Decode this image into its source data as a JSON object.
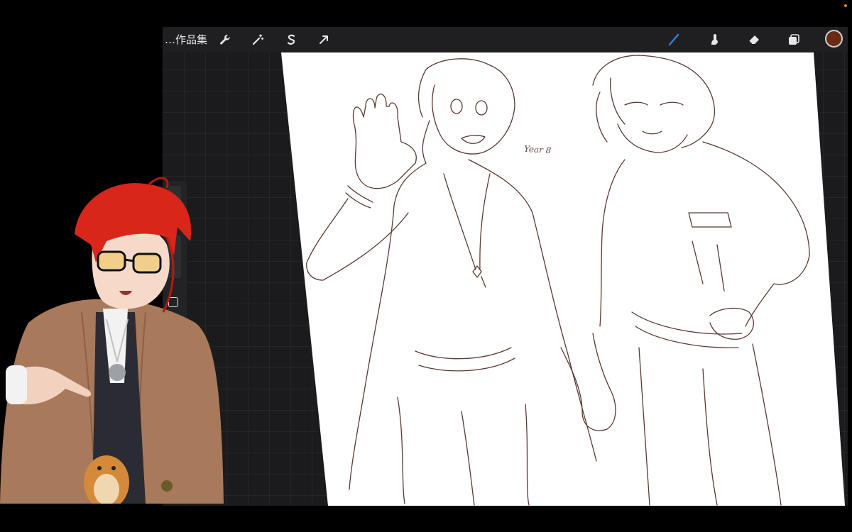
{
  "toolbar": {
    "gallery_label": "…作品集",
    "icons": [
      "wrench-icon",
      "magic-wand-icon",
      "selection-s-icon",
      "transform-arrow-icon",
      "brush-icon",
      "smudge-icon",
      "eraser-icon",
      "layers-icon",
      "color-swatch"
    ],
    "active_tool": "brush",
    "brush_color": "#2f7fe0",
    "current_color": "#6b2a14"
  },
  "canvas": {
    "annotation_text": "Year 8",
    "paper_color": "#ffffff",
    "line_color": "#5a3a30"
  },
  "avatar": {
    "hair_color": "#d8261a",
    "coat_color": "#a8795a",
    "eye_color": "#e8c64a"
  }
}
